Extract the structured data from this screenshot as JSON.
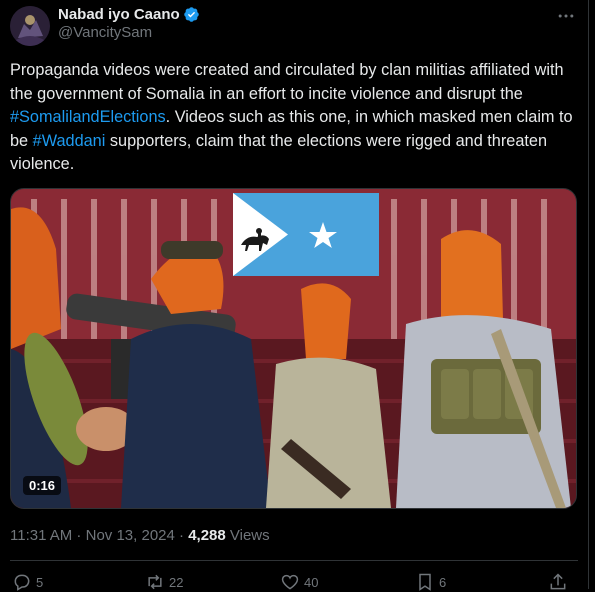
{
  "author": {
    "display_name": "Nabad iyo Caano",
    "handle": "@VancitySam",
    "verified": true,
    "verified_color": "#1d9bf0"
  },
  "tweet": {
    "segments": [
      {
        "text": "Propaganda videos were created and circulated by clan militias affiliated with the government of Somalia in an effort to incite violence and disrupt the ",
        "type": "text"
      },
      {
        "text": "#SomalilandElections",
        "type": "hashtag"
      },
      {
        "text": ". Videos such as this one, in which masked men claim to be ",
        "type": "text"
      },
      {
        "text": "#Waddani",
        "type": "hashtag"
      },
      {
        "text": " supporters, claim that the elections were rigged and threaten violence.",
        "type": "text"
      }
    ]
  },
  "media": {
    "type": "video",
    "duration": "0:16"
  },
  "meta": {
    "time": "11:31 AM",
    "separator": " · ",
    "date": "Nov 13, 2024",
    "views_count": "4,288",
    "views_label": " Views"
  },
  "actions": {
    "replies": "5",
    "reposts": "22",
    "likes": "40",
    "bookmarks": "6"
  },
  "icons": {
    "more": "more-horizontal-icon",
    "reply": "reply-icon",
    "repost": "repost-icon",
    "like": "heart-icon",
    "bookmark": "bookmark-icon",
    "share": "share-icon"
  },
  "colors": {
    "background": "#000000",
    "text": "#e7e9ea",
    "muted": "#71767b",
    "link": "#1d9bf0",
    "flag_blue": "#4aa3dc"
  }
}
